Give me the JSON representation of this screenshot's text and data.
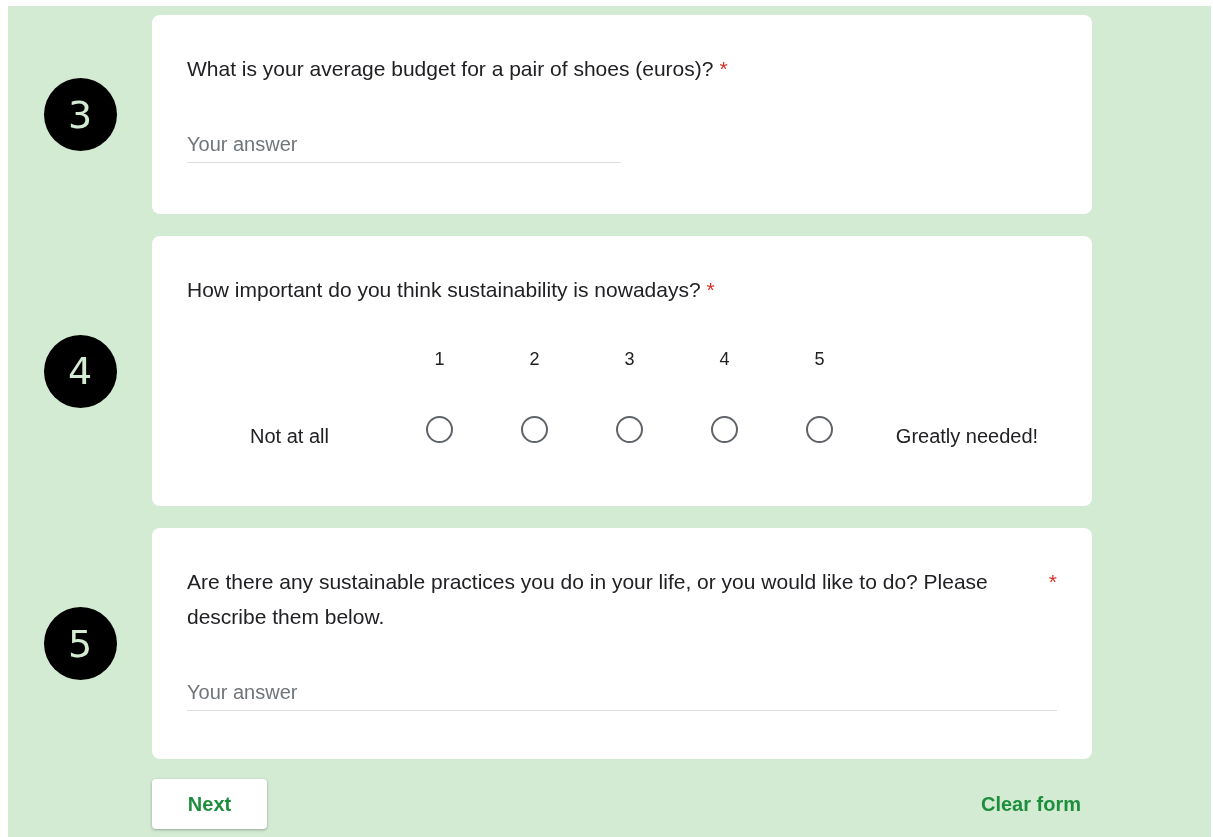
{
  "questions": [
    {
      "number": "3",
      "kind": "short",
      "title": "What is your average budget for a pair of shoes (euros)?",
      "required": true,
      "required_mark": "*",
      "placeholder": "Your answer"
    },
    {
      "number": "4",
      "kind": "scale",
      "title": "How important do you think sustainability is nowadays?",
      "required": true,
      "required_mark": "*",
      "low_label": "Not at all",
      "high_label": "Greatly needed!",
      "options": [
        {
          "label": "1",
          "selected": false
        },
        {
          "label": "2",
          "selected": false
        },
        {
          "label": "3",
          "selected": false
        },
        {
          "label": "4",
          "selected": false
        },
        {
          "label": "5",
          "selected": false
        }
      ]
    },
    {
      "number": "5",
      "kind": "paragraph",
      "title": "Are there any sustainable practices you do in your life, or you would like to do? Please describe them below.",
      "required": true,
      "required_mark": "*",
      "placeholder": "Your answer"
    }
  ],
  "buttons": {
    "next": "Next",
    "clear": "Clear form"
  }
}
